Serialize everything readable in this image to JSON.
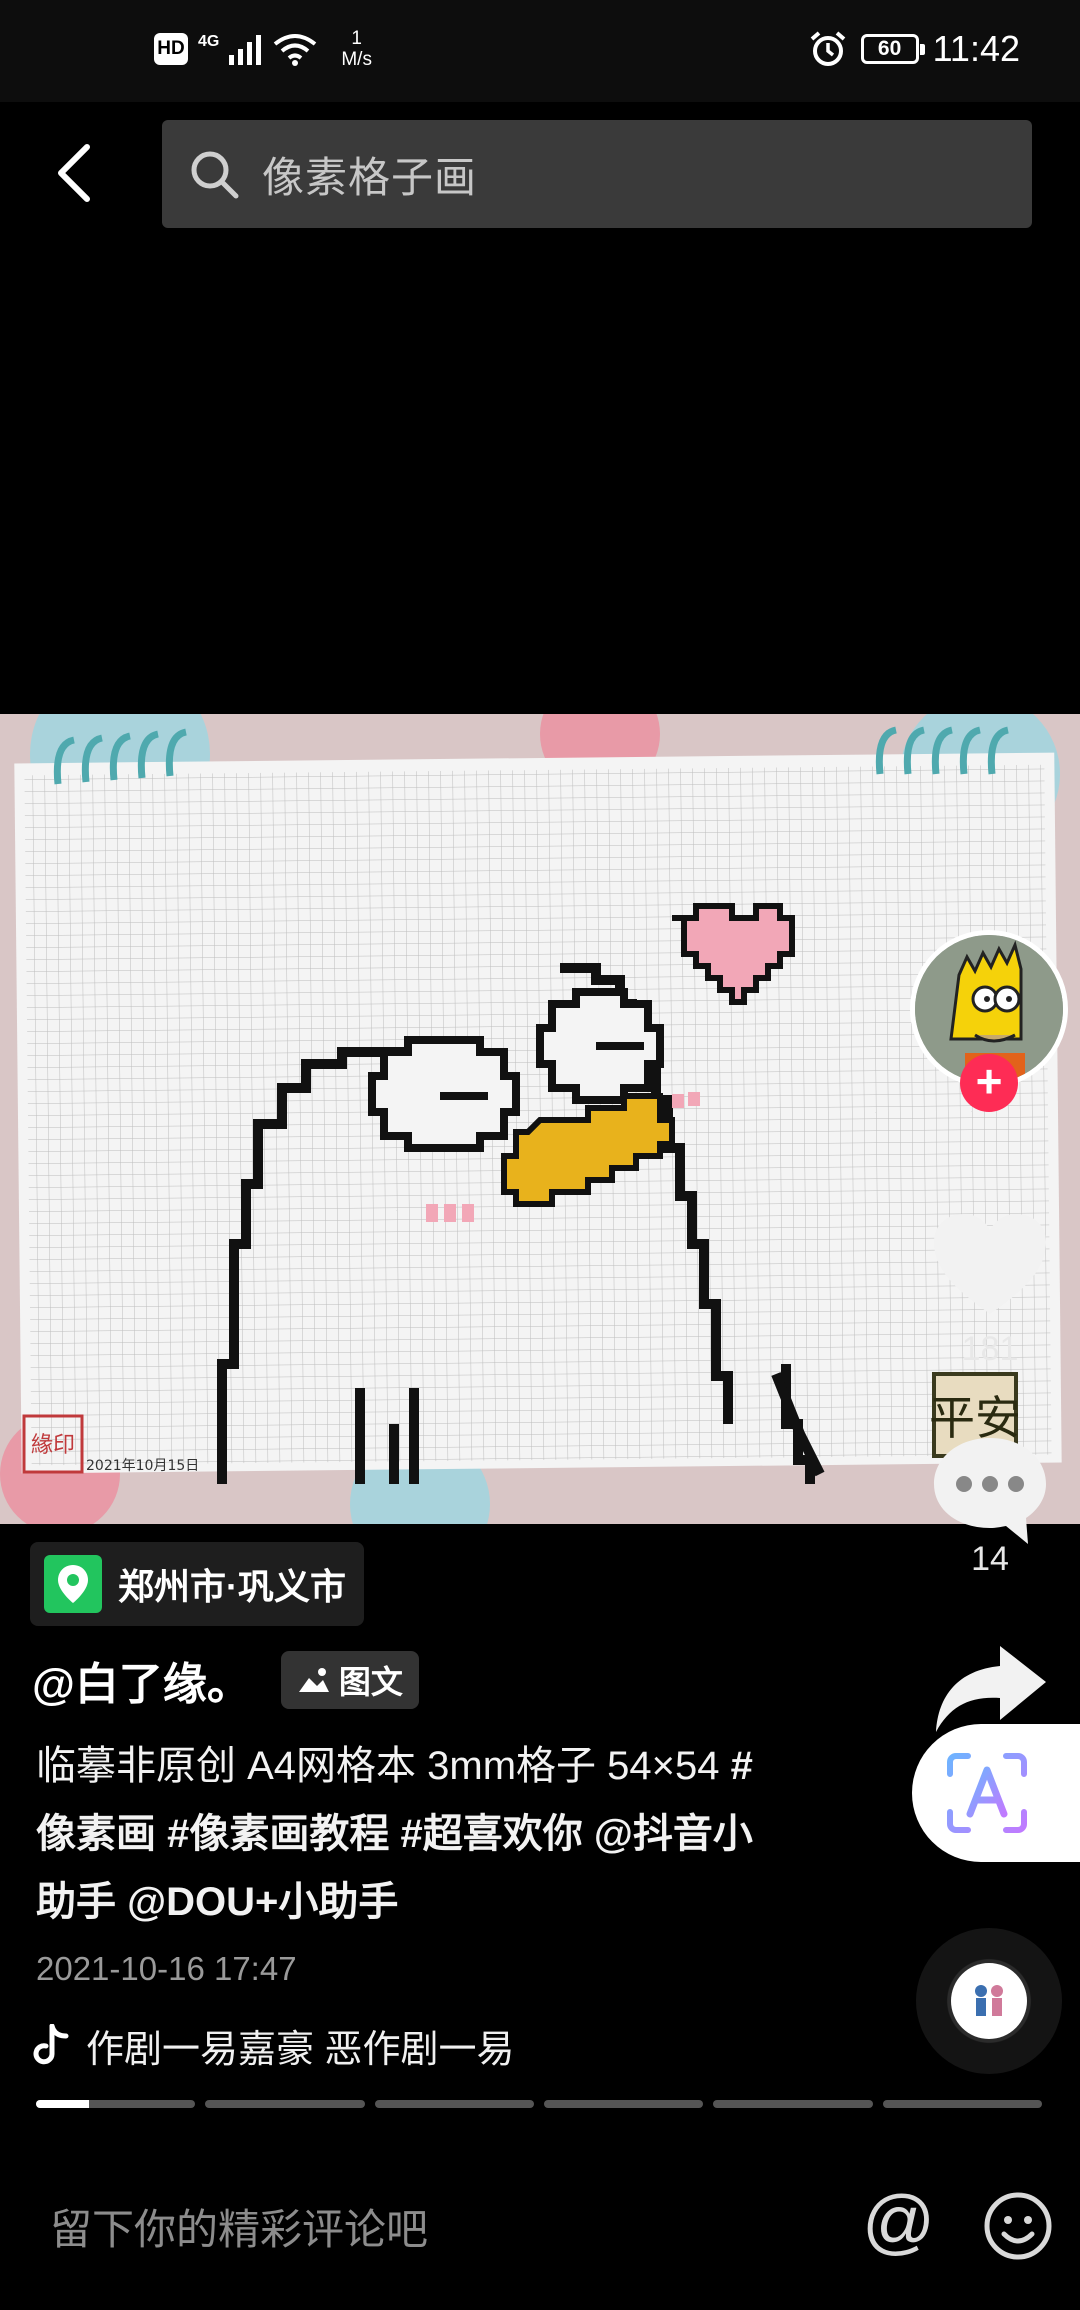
{
  "status_bar": {
    "hd": "HD",
    "network": "4G",
    "speed_value": "1",
    "speed_unit": "M/s",
    "battery": "60",
    "time": "11:42"
  },
  "search": {
    "text": "像素格子画"
  },
  "post_image": {
    "date_stamp": "2021年10月15日",
    "seal_text": "平安",
    "stamp_text": "緣印"
  },
  "actions": {
    "likes": "181",
    "comments": "14"
  },
  "location": {
    "text": "郑州市·巩义市"
  },
  "author": {
    "name": "@白了缘。",
    "type_badge": "图文"
  },
  "caption": {
    "text": "临摹非原创 A4网格本 3mm格子 54×54 ",
    "tags": [
      "#像素画",
      "#像素画教程",
      "#超喜欢你"
    ],
    "mentions": [
      "@抖音小助手",
      "@DOU+小助手"
    ]
  },
  "post_date": "2021-10-16 17:47",
  "music": {
    "title": "作剧一易嘉豪    恶作剧一易"
  },
  "progress": {
    "segments": 6,
    "current_fill": 0.33
  },
  "comment_box": {
    "placeholder": "留下你的精彩评论吧",
    "at_symbol": "@"
  },
  "colors": {
    "follow": "#fe2c55",
    "location_badge": "#22c55e",
    "duck_beak": "#e8b21c",
    "heart": "#f2a7b7"
  }
}
